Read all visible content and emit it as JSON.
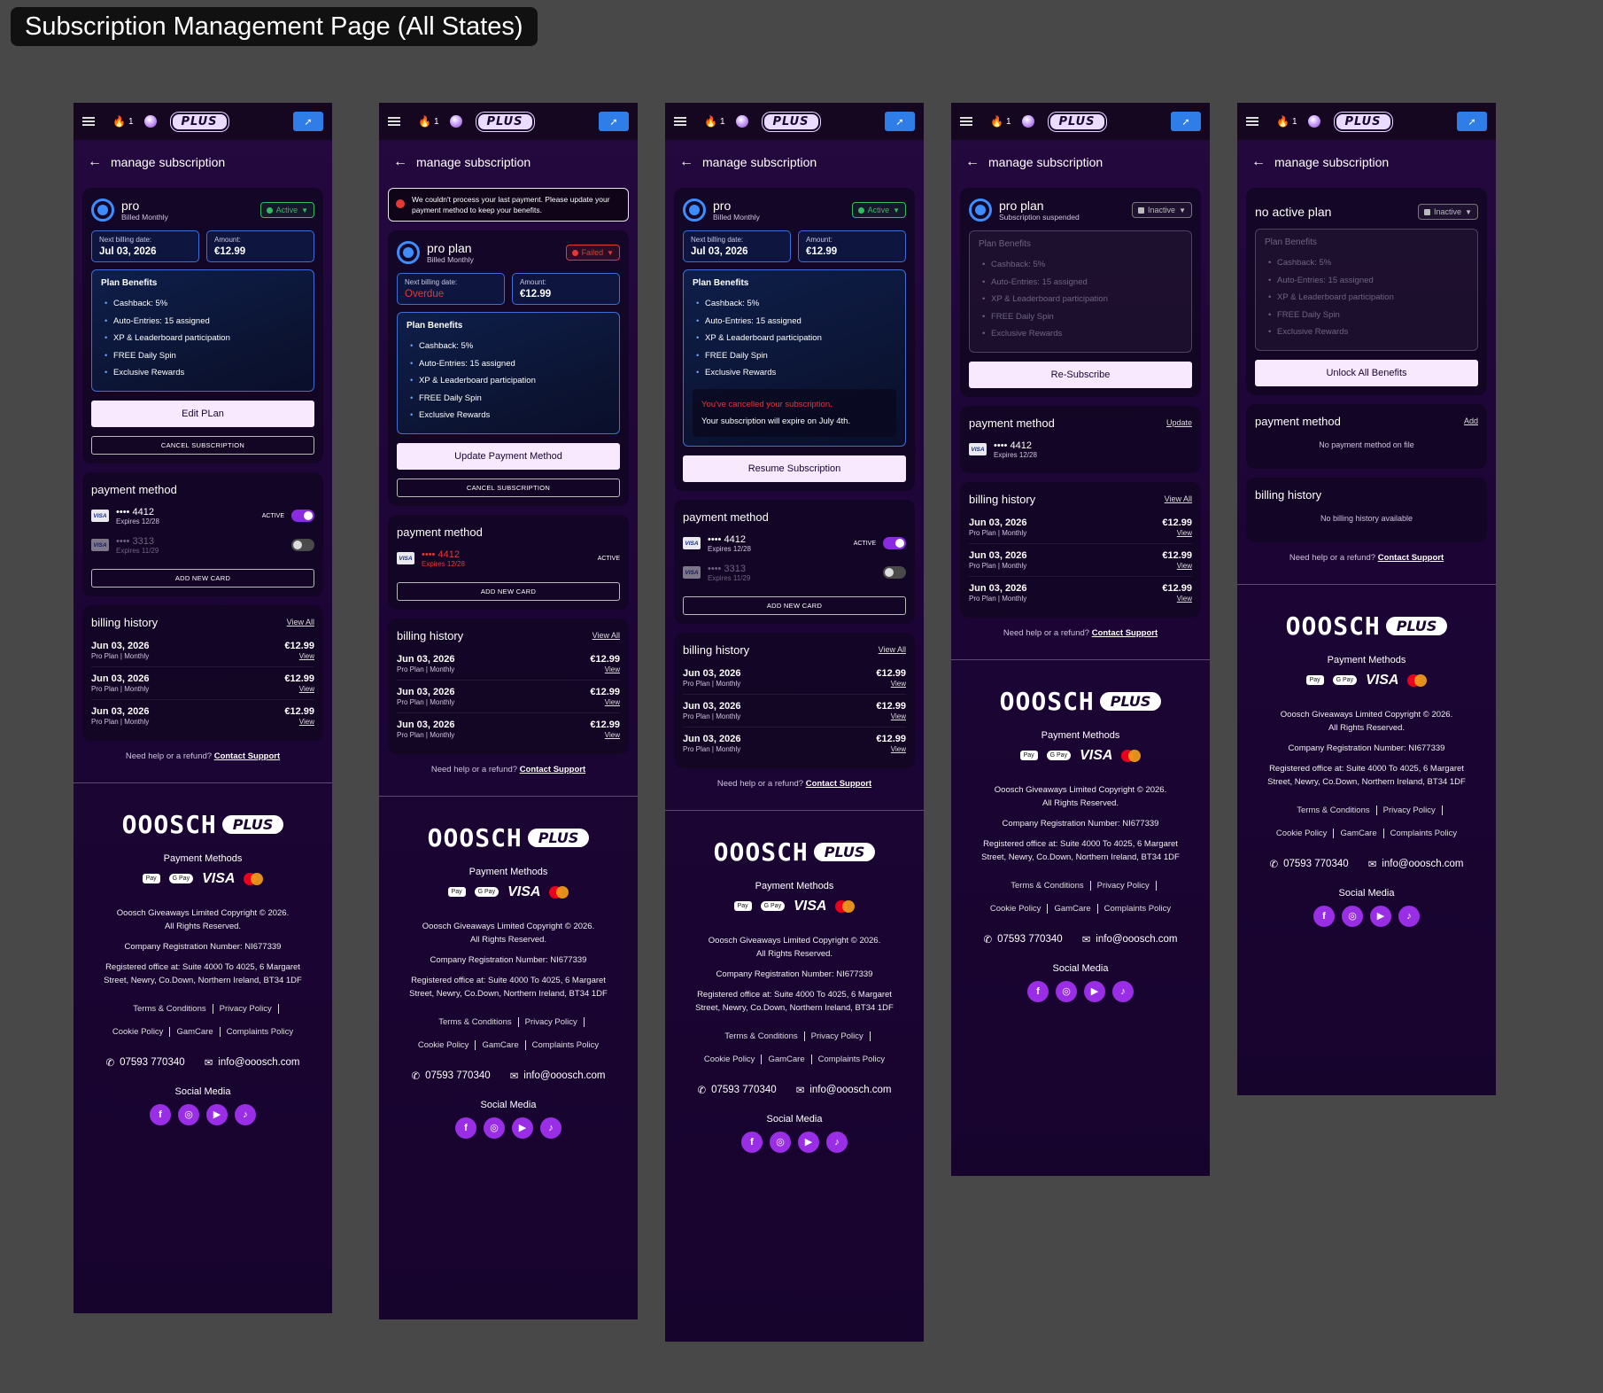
{
  "page_title": "Subscription Management Page (All States)",
  "header": {
    "streak_count": "1",
    "plus_label": "PLUS"
  },
  "back_label": "manage subscription",
  "labels": {
    "next_billing": "Next billing date:",
    "amount": "Amount:",
    "plan_benefits": "Plan Benefits",
    "cancel_subscription": "CANCEL SUBSCRIPTION",
    "payment_method": "payment method",
    "billing_history": "billing history",
    "view_all": "View All",
    "view": "View",
    "active_tag": "ACTIVE",
    "add_new_card": "ADD NEW CARD",
    "help_text": "Need help or a refund?",
    "contact_support": "Contact Support"
  },
  "benefits": [
    "Cashback: 5%",
    "Auto-Entries: 15 assigned",
    "XP & Leaderboard participation",
    "FREE Daily Spin",
    "Exclusive Rewards"
  ],
  "bills": [
    {
      "date": "Jun 03, 2026",
      "plan": "Pro Plan | Monthly",
      "amount": "€12.99"
    },
    {
      "date": "Jun 03, 2026",
      "plan": "Pro Plan | Monthly",
      "amount": "€12.99"
    },
    {
      "date": "Jun 03, 2026",
      "plan": "Pro Plan | Monthly",
      "amount": "€12.99"
    }
  ],
  "cards": [
    {
      "number": "•••• 4412",
      "expires": "Expires 12/28"
    },
    {
      "number": "•••• 3313",
      "expires": "Expires 11/29"
    }
  ],
  "states": {
    "active": {
      "plan_name": "pro",
      "plan_sub": "Billed Monthly",
      "badge": "Active",
      "next_billing": "Jul 03, 2026",
      "amount": "€12.99",
      "primary_btn": "Edit PLan"
    },
    "failed": {
      "alert": "We couldn't process your last payment. Please update your payment method to keep your benefits.",
      "plan_name": "pro plan",
      "plan_sub": "Billed Monthly",
      "badge": "Failed",
      "next_billing": "Overdue",
      "amount": "€12.99",
      "primary_btn": "Update Payment Method"
    },
    "cancelled": {
      "plan_name": "pro",
      "plan_sub": "Billed Monthly",
      "badge": "Active",
      "next_billing": "Jul 03, 2026",
      "amount": "€12.99",
      "cancel_notice": "You've cancelled your subscription.",
      "expire_notice": "Your subscription will expire on July 4th.",
      "primary_btn": "Resume Subscription"
    },
    "suspended": {
      "plan_name": "pro plan",
      "plan_sub": "Subscription suspended",
      "badge": "Inactive",
      "primary_btn": "Re-Subscribe",
      "pm_link": "Update"
    },
    "none": {
      "plan_name": "no active plan",
      "badge": "Inactive",
      "primary_btn": "Unlock All Benefits",
      "pm_link": "Add",
      "no_pm": "No payment method on file",
      "no_history": "No billing history available"
    }
  },
  "footer": {
    "brand": "OOOSCH",
    "brand_plus": "PLUS",
    "payment_methods_title": "Payment Methods",
    "pay_icons": {
      "apple": "Pay",
      "google": "G Pay",
      "visa": "VISA"
    },
    "copyright_1": "Ooosch Giveaways Limited Copyright © 2026.",
    "copyright_2": "All Rights Reserved.",
    "registration": "Company Registration Number: NI677339",
    "office_1": "Registered office at: Suite 4000 To 4025, 6 Margaret",
    "office_2": "Street, Newry, Co.Down, Northern Ireland, BT34 1DF",
    "links": [
      "Terms & Conditions",
      "Privacy Policy",
      "Cookie Policy",
      "GamCare",
      "Complaints Policy"
    ],
    "phone": "07593 770340",
    "email": "info@ooosch.com",
    "social_title": "Social Media"
  },
  "colors": {
    "accent": "#9a2ee6",
    "active": "#2fbf5f",
    "error": "#e53935",
    "info_border": "#3d6fd6"
  }
}
